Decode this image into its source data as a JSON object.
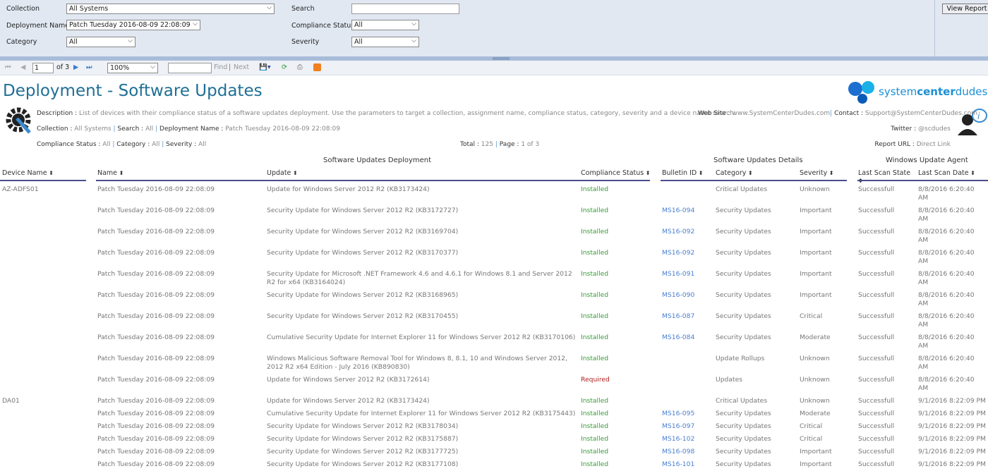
{
  "params": {
    "collection_label": "Collection",
    "collection_value": "All Systems",
    "deployment_label": "Deployment Name",
    "deployment_value": "Patch Tuesday 2016-08-09 22:08:09",
    "category_label": "Category",
    "category_value": "All",
    "search_label": "Search",
    "search_value": "",
    "compliance_label": "Compliance Status",
    "compliance_value": "All",
    "severity_label": "Severity",
    "severity_value": "All",
    "view_report": "View Report"
  },
  "toolbar": {
    "page": "1",
    "of_pages": "of 3",
    "zoom": "100%",
    "find": "Find",
    "find_sep": "|",
    "next": "Next"
  },
  "report": {
    "title": "Deployment - Software Updates",
    "logo_text_a": "system",
    "logo_text_b": "center",
    "logo_text_c": "dudes",
    "description_label": "Description :",
    "description": "List of devices with their compliance status of a software updates deployment. Use the parameters to target a collection, assignment name, compliance status, category, severity and a device name search.",
    "collection_label": "Collection :",
    "collection": "All Systems",
    "search_label": "Search :",
    "search": "All",
    "deployment_label": "Deployment Name :",
    "deployment": "Patch Tuesday 2016-08-09 22:08:09",
    "compliance_label": "Compliance Status :",
    "compliance": "All",
    "category_label": "Category :",
    "category": "All",
    "severity_label": "Severity :",
    "severity": "All",
    "total_label": "Total :",
    "total": "125",
    "page_label": "Page :",
    "page": "1 of 3",
    "website_label": "Web Site :",
    "website": "www.SystemCenterDudes.com",
    "contact_label": "Contact :",
    "contact": "Support@SystemCenterDudes.com",
    "twitter_label": "Twitter :",
    "twitter": "@scdudes",
    "url_label": "Report URL :",
    "url": "Direct Link",
    "sections": [
      "Software Updates Deployment",
      "Software Updates Details",
      "Windows Update Agent"
    ],
    "columns": [
      "Device Name",
      "Name",
      "Update",
      "Compliance Status",
      "Bulletin ID",
      "Category",
      "Severity",
      "Last Scan State",
      "Last Scan Date"
    ],
    "sort_icon": "⬍"
  },
  "colors": {
    "title": "#1f6f95",
    "installed": "#3a9a3a",
    "required": "#b02020",
    "link": "#4a7fd0",
    "header_rule": "#4a4e8c"
  },
  "rows": [
    [
      "AZ-ADFS01",
      "Patch Tuesday 2016-08-09 22:08:09",
      "Update for Windows Server 2012 R2 (KB3173424)",
      "Installed",
      "",
      "Critical Updates",
      "Unknown",
      "Successfull",
      "8/8/2016 6:20:40 AM"
    ],
    [
      "",
      "Patch Tuesday 2016-08-09 22:08:09",
      "Security Update for Windows Server 2012 R2 (KB3172727)",
      "Installed",
      "MS16-094",
      "Security Updates",
      "Important",
      "Successfull",
      "8/8/2016 6:20:40 AM"
    ],
    [
      "",
      "Patch Tuesday 2016-08-09 22:08:09",
      "Security Update for Windows Server 2012 R2 (KB3169704)",
      "Installed",
      "MS16-092",
      "Security Updates",
      "Important",
      "Successfull",
      "8/8/2016 6:20:40 AM"
    ],
    [
      "",
      "Patch Tuesday 2016-08-09 22:08:09",
      "Security Update for Windows Server 2012 R2 (KB3170377)",
      "Installed",
      "MS16-092",
      "Security Updates",
      "Important",
      "Successfull",
      "8/8/2016 6:20:40 AM"
    ],
    [
      "",
      "Patch Tuesday 2016-08-09 22:08:09",
      "Security Update for Microsoft .NET Framework 4.6 and 4.6.1 for Windows 8.1 and Server 2012 R2 for x64 (KB3164024)",
      "Installed",
      "MS16-091",
      "Security Updates",
      "Important",
      "Successfull",
      "8/8/2016 6:20:40 AM"
    ],
    [
      "",
      "Patch Tuesday 2016-08-09 22:08:09",
      "Security Update for Windows Server 2012 R2 (KB3168965)",
      "Installed",
      "MS16-090",
      "Security Updates",
      "Important",
      "Successfull",
      "8/8/2016 6:20:40 AM"
    ],
    [
      "",
      "Patch Tuesday 2016-08-09 22:08:09",
      "Security Update for Windows Server 2012 R2 (KB3170455)",
      "Installed",
      "MS16-087",
      "Security Updates",
      "Critical",
      "Successfull",
      "8/8/2016 6:20:40 AM"
    ],
    [
      "",
      "Patch Tuesday 2016-08-09 22:08:09",
      "Cumulative Security Update for Internet Explorer 11 for Windows Server 2012 R2 (KB3170106)",
      "Installed",
      "MS16-084",
      "Security Updates",
      "Moderate",
      "Successfull",
      "8/8/2016 6:20:40 AM"
    ],
    [
      "",
      "Patch Tuesday 2016-08-09 22:08:09",
      "Windows Malicious Software Removal Tool for Windows 8, 8.1, 10 and Windows Server 2012, 2012 R2 x64 Edition - July 2016 (KB890830)",
      "Installed",
      "",
      "Update Rollups",
      "Unknown",
      "Successfull",
      "8/8/2016 6:20:40 AM"
    ],
    [
      "",
      "Patch Tuesday 2016-08-09 22:08:09",
      "Update for Windows Server 2012 R2 (KB3172614)",
      "Required",
      "",
      "Updates",
      "Unknown",
      "Successfull",
      "8/8/2016 6:20:40 AM"
    ],
    [
      "DA01",
      "Patch Tuesday 2016-08-09 22:08:09",
      "Update for Windows Server 2012 R2 (KB3173424)",
      "Installed",
      "",
      "Critical Updates",
      "Unknown",
      "Successfull",
      "9/1/2016 8:22:09 PM"
    ],
    [
      "",
      "Patch Tuesday 2016-08-09 22:08:09",
      "Cumulative Security Update for Internet Explorer 11 for Windows Server 2012 R2 (KB3175443)",
      "Installed",
      "MS16-095",
      "Security Updates",
      "Moderate",
      "Successfull",
      "9/1/2016 8:22:09 PM"
    ],
    [
      "",
      "Patch Tuesday 2016-08-09 22:08:09",
      "Security Update for Windows Server 2012 R2 (KB3178034)",
      "Installed",
      "MS16-097",
      "Security Updates",
      "Critical",
      "Successfull",
      "9/1/2016 8:22:09 PM"
    ],
    [
      "",
      "Patch Tuesday 2016-08-09 22:08:09",
      "Security Update for Windows Server 2012 R2 (KB3175887)",
      "Installed",
      "MS16-102",
      "Security Updates",
      "Critical",
      "Successfull",
      "9/1/2016 8:22:09 PM"
    ],
    [
      "",
      "Patch Tuesday 2016-08-09 22:08:09",
      "Security Update for Windows Server 2012 R2 (KB3177725)",
      "Installed",
      "MS16-098",
      "Security Updates",
      "Important",
      "Successfull",
      "9/1/2016 8:22:09 PM"
    ],
    [
      "",
      "Patch Tuesday 2016-08-09 22:08:09",
      "Security Update for Windows Server 2012 R2 (KB3177108)",
      "Installed",
      "MS16-101",
      "Security Updates",
      "Important",
      "Successfull",
      "9/1/2016 8:22:09 PM"
    ]
  ]
}
